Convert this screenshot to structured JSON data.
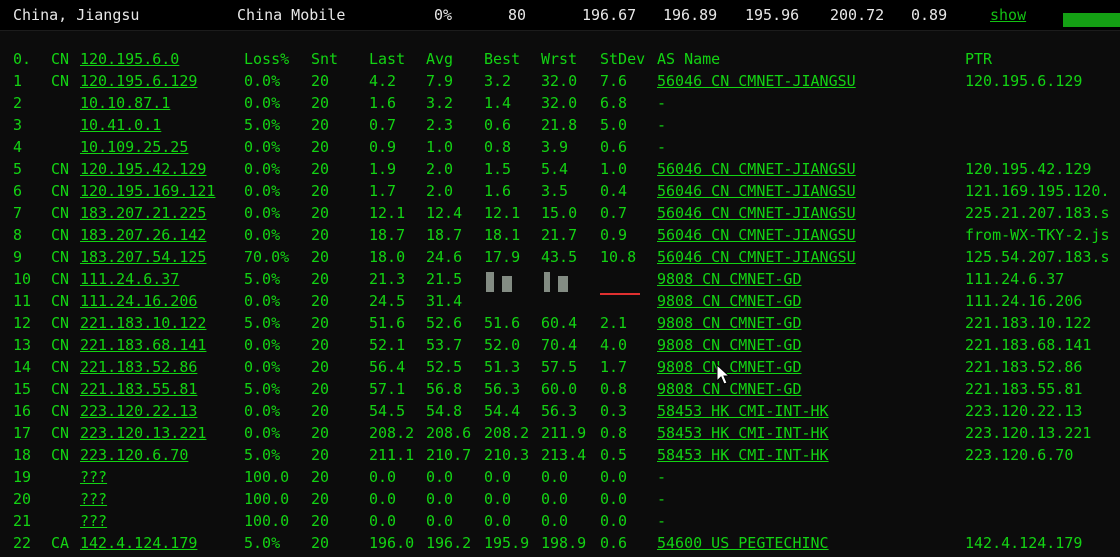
{
  "top_bar": {
    "location": "China, Jiangsu",
    "isp": "China Mobile",
    "loss": "0%",
    "snt": "80",
    "last": "196.67",
    "avg": "196.89",
    "best": "195.96",
    "wrst": "200.72",
    "stdev": "0.89",
    "show_label": "show"
  },
  "header": {
    "no": "0.",
    "cc": "CN",
    "host": "120.195.6.0",
    "loss": "Loss%",
    "snt": "Snt",
    "last": "Last",
    "avg": "Avg",
    "best": "Best",
    "wrst": "Wrst",
    "stdev": "StDev",
    "as": "AS Name",
    "ptr": "PTR"
  },
  "rows": [
    {
      "no": "1",
      "cc": "CN",
      "host": "120.195.6.129",
      "loss": "0.0%",
      "snt": "20",
      "last": "4.2",
      "avg": "7.9",
      "best": "3.2",
      "wrst": "32.0",
      "stdev": "7.6",
      "as": "56046 CN CMNET-JIANGSU",
      "ptr": "120.195.6.129"
    },
    {
      "no": "2",
      "cc": "",
      "host": "10.10.87.1",
      "loss": "0.0%",
      "snt": "20",
      "last": "1.6",
      "avg": "3.2",
      "best": "1.4",
      "wrst": "32.0",
      "stdev": "6.8",
      "as": "-",
      "ptr": ""
    },
    {
      "no": "3",
      "cc": "",
      "host": "10.41.0.1",
      "loss": "5.0%",
      "snt": "20",
      "last": "0.7",
      "avg": "2.3",
      "best": "0.6",
      "wrst": "21.8",
      "stdev": "5.0",
      "as": "-",
      "ptr": ""
    },
    {
      "no": "4",
      "cc": "",
      "host": "10.109.25.25",
      "loss": "0.0%",
      "snt": "20",
      "last": "0.9",
      "avg": "1.0",
      "best": "0.8",
      "wrst": "3.9",
      "stdev": "0.6",
      "as": "-",
      "ptr": ""
    },
    {
      "no": "5",
      "cc": "CN",
      "host": "120.195.42.129",
      "loss": "0.0%",
      "snt": "20",
      "last": "1.9",
      "avg": "2.0",
      "best": "1.5",
      "wrst": "5.4",
      "stdev": "1.0",
      "as": "56046 CN CMNET-JIANGSU",
      "ptr": "120.195.42.129"
    },
    {
      "no": "6",
      "cc": "CN",
      "host": "120.195.169.121",
      "loss": "0.0%",
      "snt": "20",
      "last": "1.7",
      "avg": "2.0",
      "best": "1.6",
      "wrst": "3.5",
      "stdev": "0.4",
      "as": "56046 CN CMNET-JIANGSU",
      "ptr": "121.169.195.120."
    },
    {
      "no": "7",
      "cc": "CN",
      "host": "183.207.21.225",
      "loss": "0.0%",
      "snt": "20",
      "last": "12.1",
      "avg": "12.4",
      "best": "12.1",
      "wrst": "15.0",
      "stdev": "0.7",
      "as": "56046 CN CMNET-JIANGSU",
      "ptr": "225.21.207.183.s"
    },
    {
      "no": "8",
      "cc": "CN",
      "host": "183.207.26.142",
      "loss": "0.0%",
      "snt": "20",
      "last": "18.7",
      "avg": "18.7",
      "best": "18.1",
      "wrst": "21.7",
      "stdev": "0.9",
      "as": "56046 CN CMNET-JIANGSU",
      "ptr": "from-WX-TKY-2.js"
    },
    {
      "no": "9",
      "cc": "CN",
      "host": "183.207.54.125",
      "loss": "70.0%",
      "snt": "20",
      "last": "18.0",
      "avg": "24.6",
      "best": "17.9",
      "wrst": "43.5",
      "stdev": "10.8",
      "as": "56046 CN CMNET-JIANGSU",
      "ptr": "125.54.207.183.s"
    },
    {
      "no": "10",
      "cc": "CN",
      "host": "111.24.6.37",
      "loss": "5.0%",
      "snt": "20",
      "last": "21.3",
      "avg": "21.5",
      "best": "",
      "wrst": "",
      "stdev": "",
      "as": "9808  CN CMNET-GD",
      "ptr": "111.24.6.37"
    },
    {
      "no": "11",
      "cc": "CN",
      "host": "111.24.16.206",
      "loss": "0.0%",
      "snt": "20",
      "last": "24.5",
      "avg": "31.4",
      "best": "",
      "wrst": "",
      "stdev": "",
      "as": "9808  CN CMNET-GD",
      "ptr": "111.24.16.206"
    },
    {
      "no": "12",
      "cc": "CN",
      "host": "221.183.10.122",
      "loss": "5.0%",
      "snt": "20",
      "last": "51.6",
      "avg": "52.6",
      "best": "51.6",
      "wrst": "60.4",
      "stdev": "2.1",
      "as": "9808  CN CMNET-GD",
      "ptr": "221.183.10.122"
    },
    {
      "no": "13",
      "cc": "CN",
      "host": "221.183.68.141",
      "loss": "0.0%",
      "snt": "20",
      "last": "52.1",
      "avg": "53.7",
      "best": "52.0",
      "wrst": "70.4",
      "stdev": "4.0",
      "as": "9808  CN CMNET-GD",
      "ptr": "221.183.68.141"
    },
    {
      "no": "14",
      "cc": "CN",
      "host": "221.183.52.86",
      "loss": "0.0%",
      "snt": "20",
      "last": "56.4",
      "avg": "52.5",
      "best": "51.3",
      "wrst": "57.5",
      "stdev": "1.7",
      "as": "9808  CN CMNET-GD",
      "ptr": "221.183.52.86"
    },
    {
      "no": "15",
      "cc": "CN",
      "host": "221.183.55.81",
      "loss": "5.0%",
      "snt": "20",
      "last": "57.1",
      "avg": "56.8",
      "best": "56.3",
      "wrst": "60.0",
      "stdev": "0.8",
      "as": "9808  CN CMNET-GD",
      "ptr": "221.183.55.81"
    },
    {
      "no": "16",
      "cc": "CN",
      "host": "223.120.22.13",
      "loss": "0.0%",
      "snt": "20",
      "last": "54.5",
      "avg": "54.8",
      "best": "54.4",
      "wrst": "56.3",
      "stdev": "0.3",
      "as": "58453 HK CMI-INT-HK",
      "ptr": "223.120.22.13"
    },
    {
      "no": "17",
      "cc": "CN",
      "host": "223.120.13.221",
      "loss": "0.0%",
      "snt": "20",
      "last": "208.2",
      "avg": "208.6",
      "best": "208.2",
      "wrst": "211.9",
      "stdev": "0.8",
      "as": "58453 HK CMI-INT-HK",
      "ptr": "223.120.13.221"
    },
    {
      "no": "18",
      "cc": "CN",
      "host": "223.120.6.70",
      "loss": "5.0%",
      "snt": "20",
      "last": "211.1",
      "avg": "210.7",
      "best": "210.3",
      "wrst": "213.4",
      "stdev": "0.5",
      "as": "58453 HK CMI-INT-HK",
      "ptr": "223.120.6.70"
    },
    {
      "no": "19",
      "cc": "",
      "host": "???",
      "loss": "100.0",
      "snt": "20",
      "last": "0.0",
      "avg": "0.0",
      "best": "0.0",
      "wrst": "0.0",
      "stdev": "0.0",
      "as": "-",
      "ptr": ""
    },
    {
      "no": "20",
      "cc": "",
      "host": "???",
      "loss": "100.0",
      "snt": "20",
      "last": "0.0",
      "avg": "0.0",
      "best": "0.0",
      "wrst": "0.0",
      "stdev": "0.0",
      "as": "-",
      "ptr": ""
    },
    {
      "no": "21",
      "cc": "",
      "host": "???",
      "loss": "100.0",
      "snt": "20",
      "last": "0.0",
      "avg": "0.0",
      "best": "0.0",
      "wrst": "0.0",
      "stdev": "0.0",
      "as": "-",
      "ptr": ""
    },
    {
      "no": "22",
      "cc": "CA",
      "host": "142.4.124.179",
      "loss": "5.0%",
      "snt": "20",
      "last": "196.0",
      "avg": "196.2",
      "best": "195.9",
      "wrst": "198.9",
      "stdev": "0.6",
      "as": "54600 US PEGTECHINC",
      "ptr": "142.4.124.179"
    }
  ],
  "colors": {
    "background": "#0c0c0c",
    "text_green": "#13d313",
    "top_text": "#e8e8e8",
    "bar_green": "#14a014"
  }
}
